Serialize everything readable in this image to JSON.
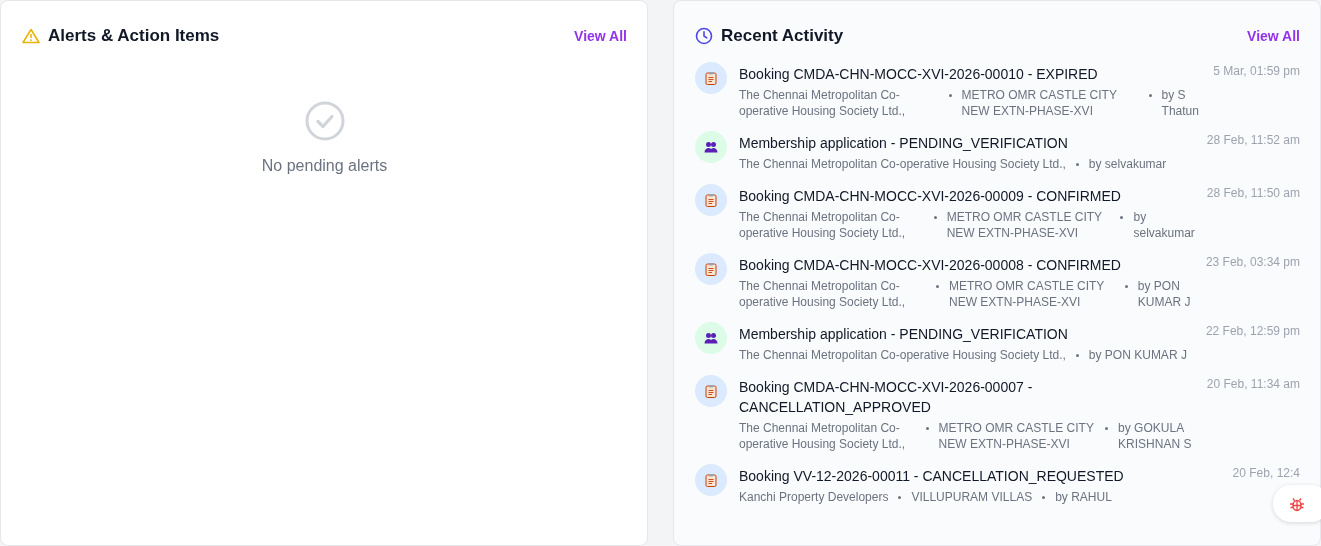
{
  "alerts": {
    "title": "Alerts & Action Items",
    "view_all": "View All",
    "empty_text": "No pending alerts"
  },
  "activity": {
    "title": "Recent Activity",
    "view_all": "View All",
    "items": [
      {
        "kind": "booking",
        "title": "Booking CMDA-CHN-MOCC-XVI-2026-00010 - EXPIRED",
        "time": "5 Mar, 01:59 pm",
        "meta": [
          "The Chennai Metropolitan Co-operative Housing Society Ltd.,",
          "METRO OMR CASTLE CITY NEW EXTN-PHASE-XVI",
          "by S Thatun"
        ]
      },
      {
        "kind": "membership",
        "title": "Membership application - PENDING_VERIFICATION",
        "time": "28 Feb, 11:52 am",
        "meta": [
          "The Chennai Metropolitan Co-operative Housing Society Ltd.,",
          "by selvakumar"
        ]
      },
      {
        "kind": "booking",
        "title": "Booking CMDA-CHN-MOCC-XVI-2026-00009 - CONFIRMED",
        "time": "28 Feb, 11:50 am",
        "meta": [
          "The Chennai Metropolitan Co-operative Housing Society Ltd.,",
          "METRO OMR CASTLE CITY NEW EXTN-PHASE-XVI",
          "by selvakumar"
        ]
      },
      {
        "kind": "booking",
        "title": "Booking CMDA-CHN-MOCC-XVI-2026-00008 - CONFIRMED",
        "time": "23 Feb, 03:34 pm",
        "meta": [
          "The Chennai Metropolitan Co-operative Housing Society Ltd.,",
          "METRO OMR CASTLE CITY NEW EXTN-PHASE-XVI",
          "by PON KUMAR J"
        ]
      },
      {
        "kind": "membership",
        "title": "Membership application - PENDING_VERIFICATION",
        "time": "22 Feb, 12:59 pm",
        "meta": [
          "The Chennai Metropolitan Co-operative Housing Society Ltd.,",
          "by PON KUMAR J"
        ]
      },
      {
        "kind": "booking",
        "title": "Booking CMDA-CHN-MOCC-XVI-2026-00007 - CANCELLATION_APPROVED",
        "time": "20 Feb, 11:34 am",
        "meta": [
          "The Chennai Metropolitan Co-operative Housing Society Ltd.,",
          "METRO OMR CASTLE CITY NEW EXTN-PHASE-XVI",
          "by GOKULA KRISHNAN S"
        ]
      },
      {
        "kind": "booking",
        "title": "Booking VV-12-2026-00011 - CANCELLATION_REQUESTED",
        "time": "20 Feb, 12:4",
        "meta": [
          "Kanchi Property Developers",
          "VILLUPURAM VILLAS",
          "by RAHUL"
        ]
      }
    ]
  }
}
